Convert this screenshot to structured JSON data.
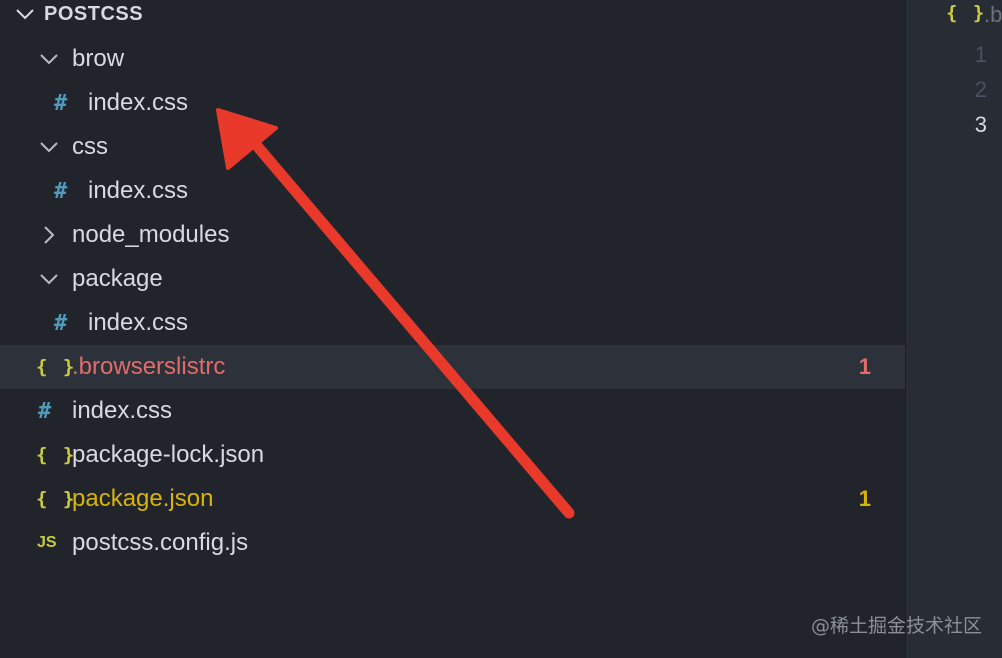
{
  "explorer": {
    "title": "POSTCSS",
    "items": [
      {
        "label": "brow",
        "kind": "folder",
        "expanded": true
      },
      {
        "label": "index.css",
        "kind": "css",
        "icon": "#"
      },
      {
        "label": "css",
        "kind": "folder",
        "expanded": true
      },
      {
        "label": "index.css",
        "kind": "css",
        "icon": "#"
      },
      {
        "label": "node_modules",
        "kind": "folder",
        "expanded": false
      },
      {
        "label": "package",
        "kind": "folder",
        "expanded": true
      },
      {
        "label": "index.css",
        "kind": "css",
        "icon": "#"
      },
      {
        "label": ".browserslistrc",
        "kind": "json",
        "icon": "{ }",
        "status": "error",
        "badge": "1",
        "selected": true
      },
      {
        "label": "index.css",
        "kind": "css",
        "icon": "#"
      },
      {
        "label": "package-lock.json",
        "kind": "json",
        "icon": "{ }"
      },
      {
        "label": "package.json",
        "kind": "json",
        "icon": "{ }",
        "status": "warn",
        "badge": "1"
      },
      {
        "label": "postcss.config.js",
        "kind": "js",
        "icon": "JS"
      }
    ]
  },
  "editor": {
    "tab_icon": "{ }",
    "tab_label": ".b",
    "line_numbers": [
      "1",
      "2",
      "3"
    ]
  },
  "watermark": "@稀土掘金技术社区",
  "colors": {
    "sidebar_bg": "#21252b",
    "editor_bg": "#282c34",
    "selected_bg": "#2c313a",
    "text": "#d7dae0",
    "error": "#e06c6c",
    "warning": "#d8b40b",
    "css_icon": "#519aba",
    "json_icon": "#cbcb41",
    "annotation_arrow": "#e8392b"
  }
}
